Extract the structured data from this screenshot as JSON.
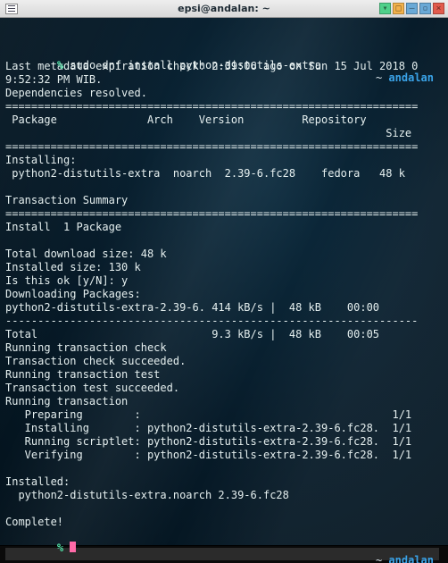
{
  "window": {
    "title": "epsi@andalan: ~"
  },
  "prompt1": {
    "symbol": "%",
    "command": "sudo dnf install python-distutils-extra",
    "tilde": "~",
    "host": "andalan"
  },
  "output": {
    "l01": "Last metadata expiration check: 2:39:06 ago on Sun 15 Jul 2018 0",
    "l02": "9:52:32 PM WIB.",
    "l03": "Dependencies resolved.",
    "l04": "================================================================",
    "l05": " Package              Arch    Version         Repository",
    "l06": "                                                           Size",
    "l07": "================================================================",
    "l08": "Installing:",
    "l09": " python2-distutils-extra  noarch  2.39-6.fc28    fedora   48 k",
    "l10": "",
    "l11": "Transaction Summary",
    "l12": "================================================================",
    "l13": "Install  1 Package",
    "l14": "",
    "l15": "Total download size: 48 k",
    "l16": "Installed size: 130 k",
    "l17": "Is this ok [y/N]: y",
    "l18": "Downloading Packages:",
    "l19": "python2-distutils-extra-2.39-6. 414 kB/s |  48 kB    00:00",
    "l20": "----------------------------------------------------------------",
    "l21": "Total                           9.3 kB/s |  48 kB    00:05",
    "l22": "Running transaction check",
    "l23": "Transaction check succeeded.",
    "l24": "Running transaction test",
    "l25": "Transaction test succeeded.",
    "l26": "Running transaction",
    "l27": "   Preparing        :                                       1/1",
    "l28": "   Installing       : python2-distutils-extra-2.39-6.fc28.  1/1",
    "l29": "   Running scriptlet: python2-distutils-extra-2.39-6.fc28.  1/1",
    "l30": "   Verifying        : python2-distutils-extra-2.39-6.fc28.  1/1",
    "l31": "",
    "l32": "Installed:",
    "l33": "  python2-distutils-extra.noarch 2.39-6.fc28",
    "l34": "",
    "l35": "Complete!"
  },
  "prompt2": {
    "symbol": "%",
    "tilde": "~",
    "host": "andalan"
  }
}
